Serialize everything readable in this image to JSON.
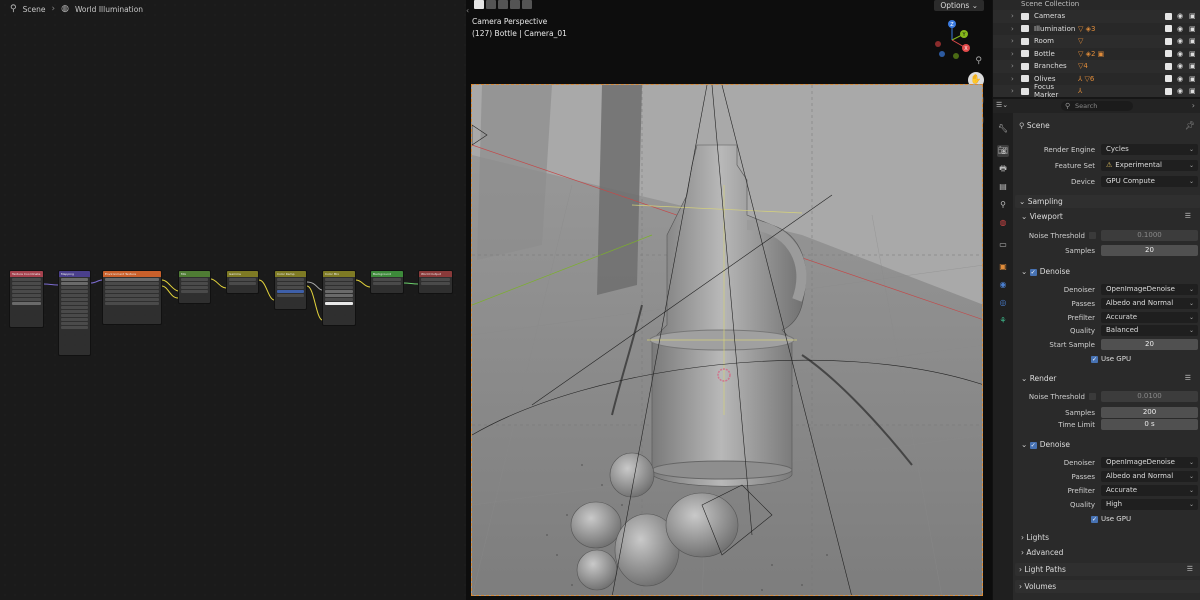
{
  "node_editor": {
    "breadcrumb": [
      "Scene",
      "World Illumination"
    ],
    "nodes": [
      {
        "title": "Texture Coordinate",
        "color": "#a5424e"
      },
      {
        "title": "Mapping",
        "color": "#4a3f8c"
      },
      {
        "title": "Environment Texture",
        "color": "#c9602b"
      },
      {
        "title": "Mix",
        "color": "#4f7c34"
      },
      {
        "title": "Gamma",
        "color": "#7e7a24"
      },
      {
        "title": "Color Ramp",
        "color": "#7e7a24"
      },
      {
        "title": "Color Mix",
        "color": "#7e7a24"
      },
      {
        "title": "Background",
        "color": "#3d8a3a"
      },
      {
        "title": "World Output",
        "color": "#8a3a3a"
      }
    ]
  },
  "viewport": {
    "options_label": "Options",
    "info_line1": "Camera Perspective",
    "info_line2": "(127) Bottle | Camera_01",
    "gizmo": {
      "z": "Z",
      "y": "Y",
      "x": "X"
    }
  },
  "outliner": {
    "title": "Scene Collection",
    "rows": [
      {
        "name": "Cameras",
        "extra": ""
      },
      {
        "name": "Illumination",
        "extra": "▽ ◈3"
      },
      {
        "name": "Room",
        "extra": "▽"
      },
      {
        "name": "Bottle",
        "extra": "▽ ◈2 ▣"
      },
      {
        "name": "Branches",
        "extra": "▽4"
      },
      {
        "name": "Olives",
        "extra": "⅄ ▽6"
      },
      {
        "name": "Focus Marker",
        "extra": "⅄"
      }
    ]
  },
  "properties": {
    "search_placeholder": "Search",
    "scene_label": "Scene",
    "render_engine_label": "Render Engine",
    "render_engine": "Cycles",
    "feature_set_label": "Feature Set",
    "feature_set": "Experimental",
    "device_label": "Device",
    "device": "GPU Compute",
    "sampling": "Sampling",
    "viewport_label": "Viewport",
    "vp_noise_label": "Noise Threshold",
    "vp_noise": "0.1000",
    "vp_samples_label": "Samples",
    "vp_samples": "20",
    "vp_denoise": "Denoise",
    "vp_denoiser_label": "Denoiser",
    "vp_denoiser": "OpenImageDenoise",
    "vp_passes_label": "Passes",
    "vp_passes": "Albedo and Normal",
    "vp_prefilter_label": "Prefilter",
    "vp_prefilter": "Accurate",
    "vp_quality_label": "Quality",
    "vp_quality": "Balanced",
    "vp_start_label": "Start Sample",
    "vp_start": "20",
    "vp_gpu": "Use GPU",
    "render_label": "Render",
    "r_noise_label": "Noise Threshold",
    "r_noise": "0.0100",
    "r_samples_label": "Samples",
    "r_samples": "200",
    "r_time_label": "Time Limit",
    "r_time": "0 s",
    "r_denoise": "Denoise",
    "r_denoiser_label": "Denoiser",
    "r_denoiser": "OpenImageDenoise",
    "r_passes_label": "Passes",
    "r_passes": "Albedo and Normal",
    "r_prefilter_label": "Prefilter",
    "r_prefilter": "Accurate",
    "r_quality_label": "Quality",
    "r_quality": "High",
    "r_gpu": "Use GPU",
    "lights": "Lights",
    "advanced": "Advanced",
    "light_paths": "Light Paths",
    "volumes": "Volumes"
  }
}
